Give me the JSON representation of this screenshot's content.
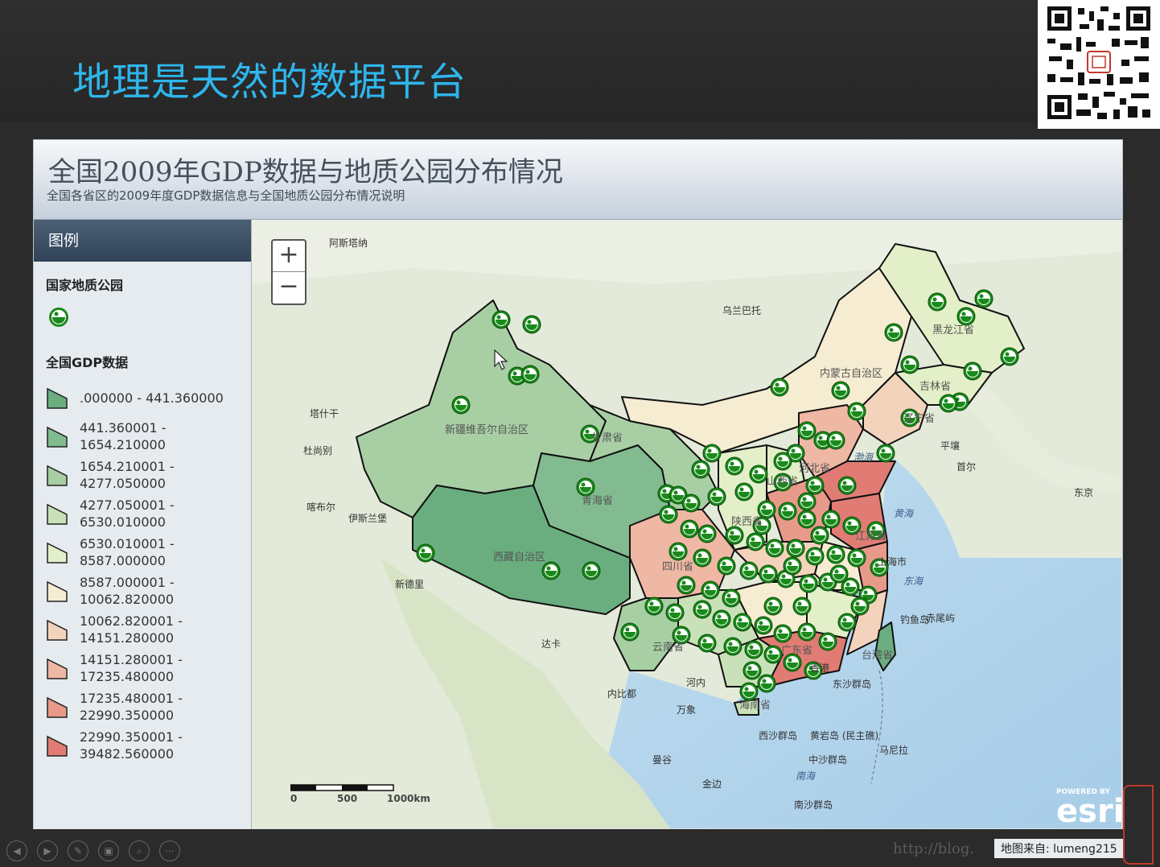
{
  "slide": {
    "title": "地理是天然的数据平台"
  },
  "app": {
    "title": "全国2009年GDP数据与地质公园分布情况",
    "subtitle": "全国各省区的2009年度GDP数据信息与全国地质公园分布情况说明"
  },
  "legend": {
    "header": "图例",
    "park_section": "国家地质公园",
    "gdp_section": "全国GDP数据",
    "classes": [
      {
        "label": ".000000 - 441.360000",
        "color": "#6aae80"
      },
      {
        "label": "441.360001 -\n1654.210000",
        "color": "#82bb8f"
      },
      {
        "label": "1654.210001 -\n4277.050000",
        "color": "#a8cfa4"
      },
      {
        "label": "4277.050001 -\n6530.010000",
        "color": "#c9e1b8"
      },
      {
        "label": "6530.010001 -\n8587.000000",
        "color": "#e3efc8"
      },
      {
        "label": "8587.000001 -\n10062.820000",
        "color": "#f6ecd2"
      },
      {
        "label": "10062.820001 -\n14151.280000",
        "color": "#f4d3bc"
      },
      {
        "label": "14151.280001 -\n17235.480000",
        "color": "#eeb8a4"
      },
      {
        "label": "17235.480001 -\n22990.350000",
        "color": "#e79a8a"
      },
      {
        "label": "22990.350001 -\n39482.560000",
        "color": "#e07c74"
      }
    ]
  },
  "map": {
    "zoom_in": "+",
    "zoom_out": "−",
    "scale_labels": [
      "0",
      "500",
      "1000km"
    ],
    "esri_powered": "POWERED BY",
    "esri_name": "esri",
    "labels": [
      {
        "t": "阿斯塔纳"
      },
      {
        "t": "乌兰巴托"
      },
      {
        "t": "塔什干"
      },
      {
        "t": "杜尚别"
      },
      {
        "t": "喀布尔"
      },
      {
        "t": "伊斯兰堡"
      },
      {
        "t": "新德里"
      },
      {
        "t": "达卡"
      },
      {
        "t": "内比都"
      },
      {
        "t": "河内"
      },
      {
        "t": "万象"
      },
      {
        "t": "曼谷"
      },
      {
        "t": "金边"
      },
      {
        "t": "平壤"
      },
      {
        "t": "首尔"
      },
      {
        "t": "东京"
      },
      {
        "t": "马尼拉"
      },
      {
        "t": "钓鱼岛"
      },
      {
        "t": "赤尾屿"
      },
      {
        "t": "东沙群岛"
      },
      {
        "t": "西沙群岛"
      },
      {
        "t": "黄岩岛 (民主礁)"
      },
      {
        "t": "中沙群岛"
      },
      {
        "t": "南沙群岛"
      },
      {
        "t": "新疆维吾尔自治区"
      },
      {
        "t": "西藏自治区"
      },
      {
        "t": "青海省"
      },
      {
        "t": "甘肃省"
      },
      {
        "t": "内蒙古自治区"
      },
      {
        "t": "黑龙江省"
      },
      {
        "t": "吉林省"
      },
      {
        "t": "辽宁省"
      },
      {
        "t": "河北省"
      },
      {
        "t": "山西省"
      },
      {
        "t": "陕西省"
      },
      {
        "t": "四川省"
      },
      {
        "t": "云南省"
      },
      {
        "t": "广东省"
      },
      {
        "t": "台湾省"
      },
      {
        "t": "江苏省"
      },
      {
        "t": "海南省"
      },
      {
        "t": "香港"
      },
      {
        "t": "渤海"
      },
      {
        "t": "黄海"
      },
      {
        "t": "东海"
      },
      {
        "t": "南海"
      },
      {
        "t": "上海市"
      }
    ]
  },
  "footer": {
    "credit": "地图来自: lumeng215",
    "watermark": "http://blog."
  },
  "colors": {
    "title_accent": "#2fb6ec",
    "park_marker": "#1a8a1a"
  }
}
